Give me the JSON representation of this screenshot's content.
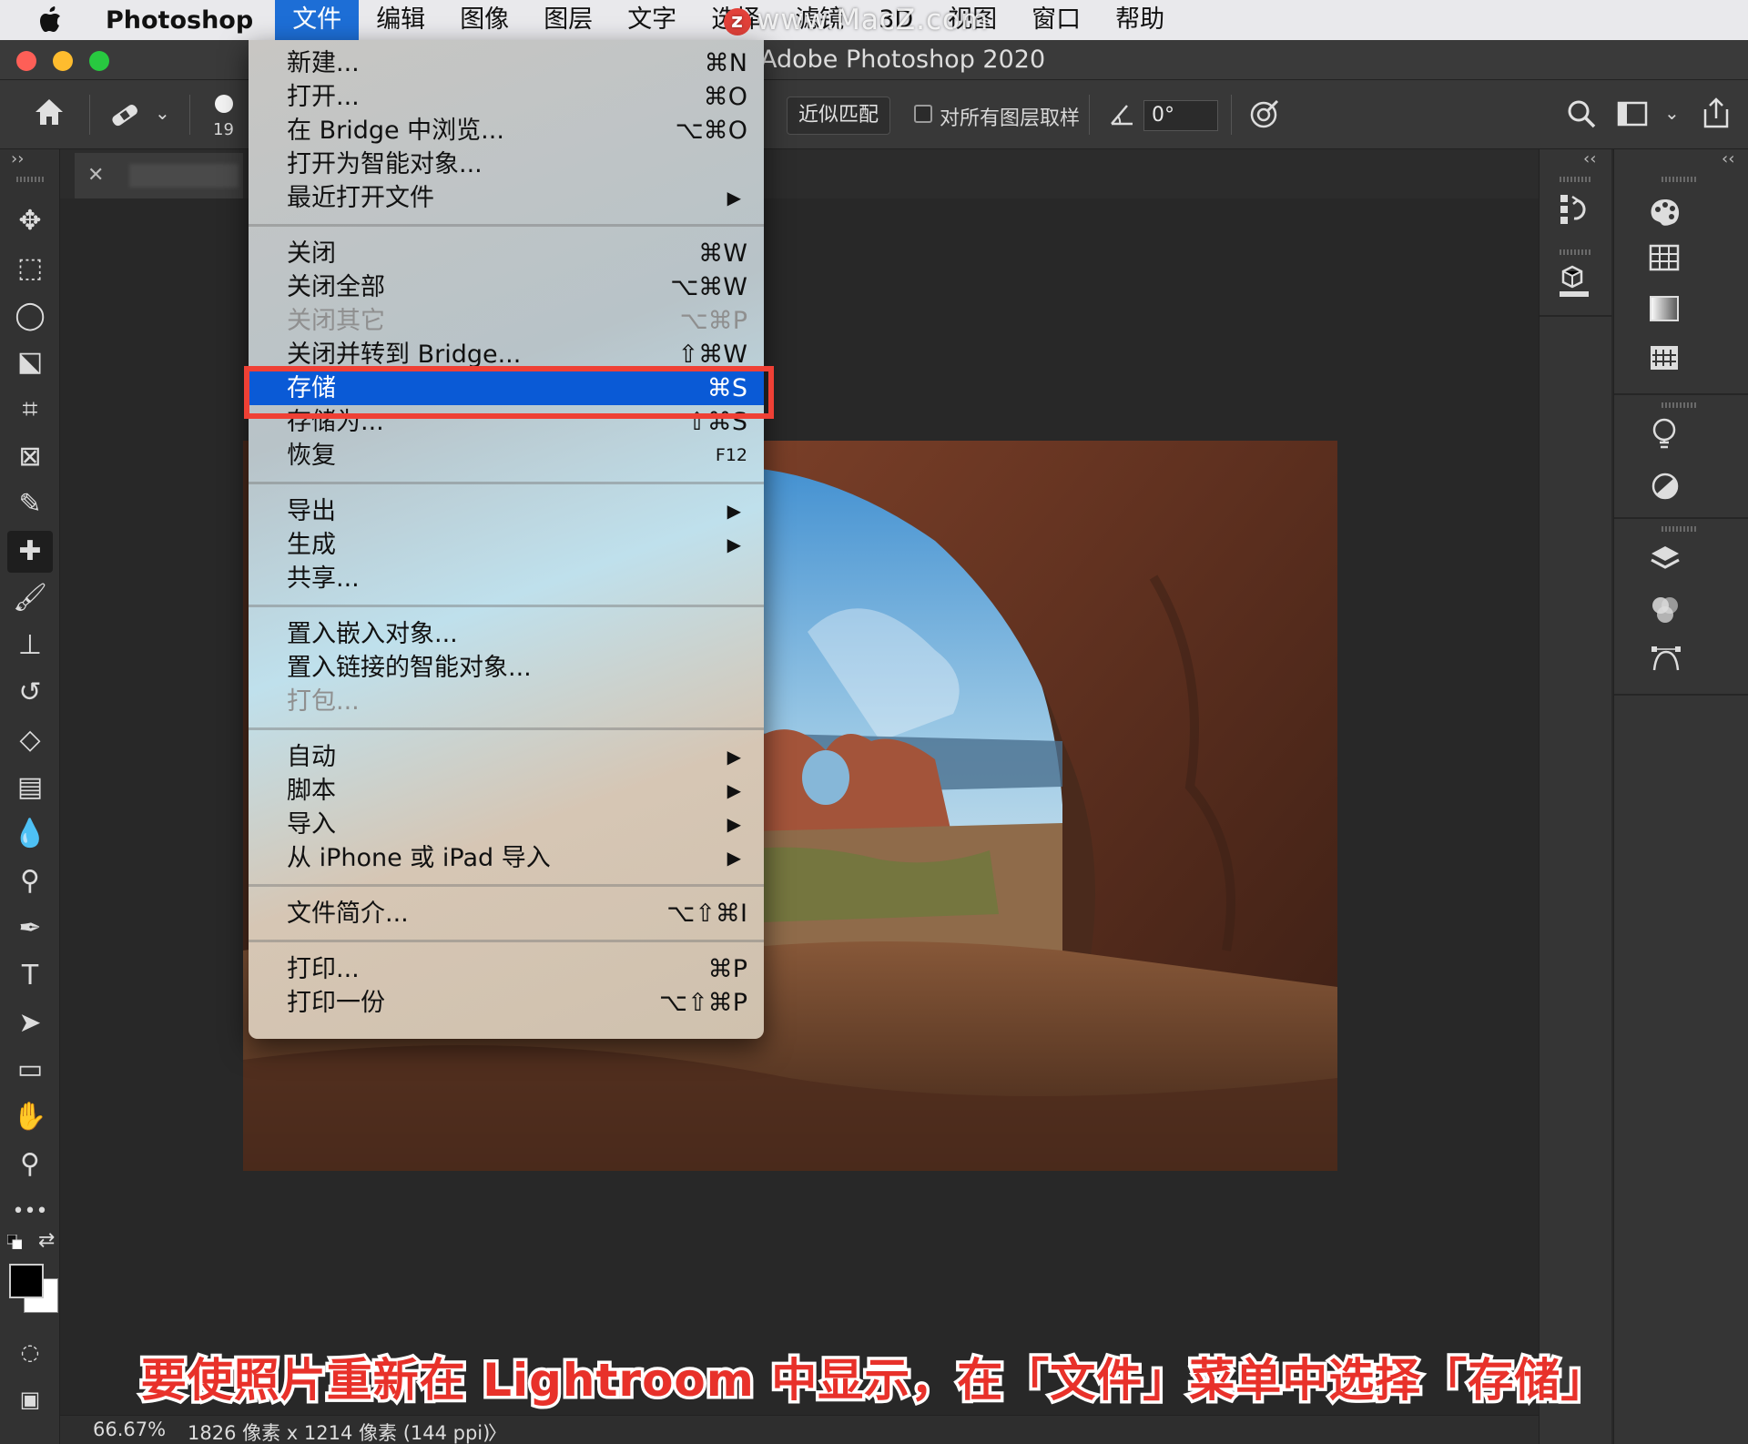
{
  "menubar": {
    "app_name": "Photoshop",
    "items": [
      "文件",
      "编辑",
      "图像",
      "图层",
      "文字",
      "选择",
      "滤镜",
      "3D",
      "视图",
      "窗口",
      "帮助"
    ],
    "active_index": 0
  },
  "watermark": "www.MacZ.com",
  "window": {
    "title": "Adobe Photoshop 2020"
  },
  "options_bar": {
    "brush_size": "19",
    "mode_button": "近似匹配",
    "sample_all_layers_label": "对所有图层取样",
    "angle_value": "0°"
  },
  "file_menu": {
    "groups": [
      [
        {
          "label": "新建...",
          "shortcut": "⌘N"
        },
        {
          "label": "打开...",
          "shortcut": "⌘O"
        },
        {
          "label": "在 Bridge 中浏览...",
          "shortcut": "⌥⌘O"
        },
        {
          "label": "打开为智能对象..."
        },
        {
          "label": "最近打开文件",
          "submenu": true
        }
      ],
      [
        {
          "label": "关闭",
          "shortcut": "⌘W"
        },
        {
          "label": "关闭全部",
          "shortcut": "⌥⌘W"
        },
        {
          "label": "关闭其它",
          "shortcut": "⌥⌘P",
          "disabled": true
        },
        {
          "label": "关闭并转到 Bridge...",
          "shortcut": "⇧⌘W"
        },
        {
          "label": "存储",
          "shortcut": "⌘S",
          "selected": true
        },
        {
          "label": "存储为...",
          "shortcut": "⇧⌘S"
        },
        {
          "label": "恢复",
          "shortcut": "F12"
        }
      ],
      [
        {
          "label": "导出",
          "submenu": true
        },
        {
          "label": "生成",
          "submenu": true
        },
        {
          "label": "共享..."
        }
      ],
      [
        {
          "label": "置入嵌入对象..."
        },
        {
          "label": "置入链接的智能对象..."
        },
        {
          "label": "打包...",
          "disabled": true
        }
      ],
      [
        {
          "label": "自动",
          "submenu": true
        },
        {
          "label": "脚本",
          "submenu": true
        },
        {
          "label": "导入",
          "submenu": true
        },
        {
          "label": "从 iPhone 或 iPad 导入",
          "submenu": true
        }
      ],
      [
        {
          "label": "文件简介...",
          "shortcut": "⌥⇧⌘I"
        }
      ],
      [
        {
          "label": "打印...",
          "shortcut": "⌘P"
        },
        {
          "label": "打印一份",
          "shortcut": "⌥⇧⌘P"
        }
      ]
    ],
    "submenu_arrow": "▶"
  },
  "status_bar": {
    "zoom": "66.67%",
    "doc_info": "1826 像素 x 1214 像素 (144 ppi)",
    "more": "〉"
  },
  "caption": "要使照片重新在 Lightroom 中显示，在「文件」菜单中选择「存储」",
  "colors": {
    "menu_selected": "#0a5ad6",
    "highlight_box": "#ef4035",
    "caption_text": "#e8312a"
  }
}
